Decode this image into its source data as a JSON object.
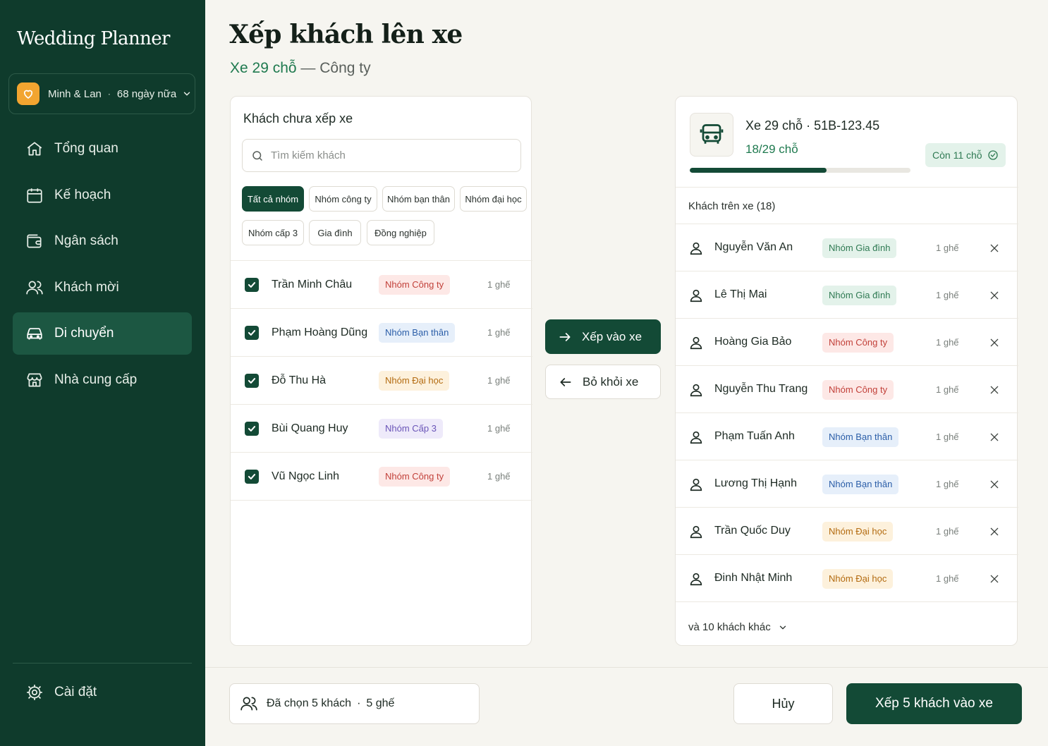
{
  "app": {
    "title": "Wedding Planner"
  },
  "couple": {
    "names": "Minh & Lan",
    "separator": "·",
    "countdown": "68 ngày nữa"
  },
  "nav": [
    {
      "label": "Tổng quan",
      "icon": "home-icon"
    },
    {
      "label": "Kế hoạch",
      "icon": "calendar-icon"
    },
    {
      "label": "Ngân sách",
      "icon": "wallet-icon"
    },
    {
      "label": "Khách mời",
      "icon": "users-icon"
    },
    {
      "label": "Di chuyển",
      "icon": "car-icon",
      "active": true
    },
    {
      "label": "Nhà cung cấp",
      "icon": "store-icon"
    }
  ],
  "settings": {
    "label": "Cài đặt"
  },
  "page": {
    "title": "Xếp khách lên xe",
    "vehicle": "Xe 29 chỗ",
    "dash": " — ",
    "group": "Công ty"
  },
  "unassigned": {
    "title": "Khách chưa xếp xe",
    "search_placeholder": "Tìm kiếm khách",
    "filters": [
      "Tất cả nhóm",
      "Nhóm công ty",
      "Nhóm bạn thân",
      "Nhóm đại học",
      "Nhóm cấp 3",
      "Gia đình",
      "Đồng nghiệp"
    ],
    "active_filter": "Tất cả nhóm",
    "guests": [
      {
        "name": "Trần Minh Châu",
        "group": "Nhóm Công ty",
        "group_type": "cong",
        "seats": "1 ghế",
        "checked": true
      },
      {
        "name": "Phạm Hoàng Dũng",
        "group": "Nhóm Bạn thân",
        "group_type": "banthan",
        "seats": "1 ghế",
        "checked": true
      },
      {
        "name": "Đỗ Thu Hà",
        "group": "Nhóm Đại học",
        "group_type": "daihoc",
        "seats": "1 ghế",
        "checked": true
      },
      {
        "name": "Bùi Quang Huy",
        "group": "Nhóm Cấp 3",
        "group_type": "cap3",
        "seats": "1 ghế",
        "checked": true
      },
      {
        "name": "Vũ Ngọc Linh",
        "group": "Nhóm Công ty",
        "group_type": "cong",
        "seats": "1 ghế",
        "checked": true
      }
    ]
  },
  "actions": {
    "assign": "Xếp vào xe",
    "remove": "Bỏ khỏi xe"
  },
  "vehicle": {
    "name": "Xe 29 chỗ",
    "separator": "·",
    "plate": "51B-123.45",
    "occupancy": "18/29 chỗ",
    "filled": 18,
    "capacity": 29,
    "remaining": "Còn 11 chỗ",
    "passengers_title": "Khách trên xe (18)",
    "passengers": [
      {
        "name": "Nguyễn Văn An",
        "group": "Nhóm Gia đình",
        "group_type": "giadinh",
        "seats": "1 ghế"
      },
      {
        "name": "Lê Thị Mai",
        "group": "Nhóm Gia đình",
        "group_type": "giadinh",
        "seats": "1 ghế"
      },
      {
        "name": "Hoàng Gia Bảo",
        "group": "Nhóm Công ty",
        "group_type": "cong",
        "seats": "1 ghế"
      },
      {
        "name": "Nguyễn Thu Trang",
        "group": "Nhóm Công ty",
        "group_type": "cong",
        "seats": "1 ghế"
      },
      {
        "name": "Phạm Tuấn Anh",
        "group": "Nhóm Bạn thân",
        "group_type": "banthan",
        "seats": "1 ghế"
      },
      {
        "name": "Lương Thị Hạnh",
        "group": "Nhóm Bạn thân",
        "group_type": "banthan",
        "seats": "1 ghế"
      },
      {
        "name": "Trần Quốc Duy",
        "group": "Nhóm Đại học",
        "group_type": "daihoc",
        "seats": "1 ghế"
      },
      {
        "name": "Đinh Nhật Minh",
        "group": "Nhóm Đại học",
        "group_type": "daihoc",
        "seats": "1 ghế"
      }
    ],
    "more": "và 10 khách khác"
  },
  "footer": {
    "selected": "Đã chọn 5 khách",
    "separator": "·",
    "seats": "5 ghế",
    "cancel": "Hủy",
    "submit": "Xếp 5 khách vào xe"
  },
  "colors": {
    "sidebar": "#0f3b2c",
    "primary": "#134a36",
    "accent_green": "#1f7a4f",
    "brand_orange": "#f2a530"
  }
}
